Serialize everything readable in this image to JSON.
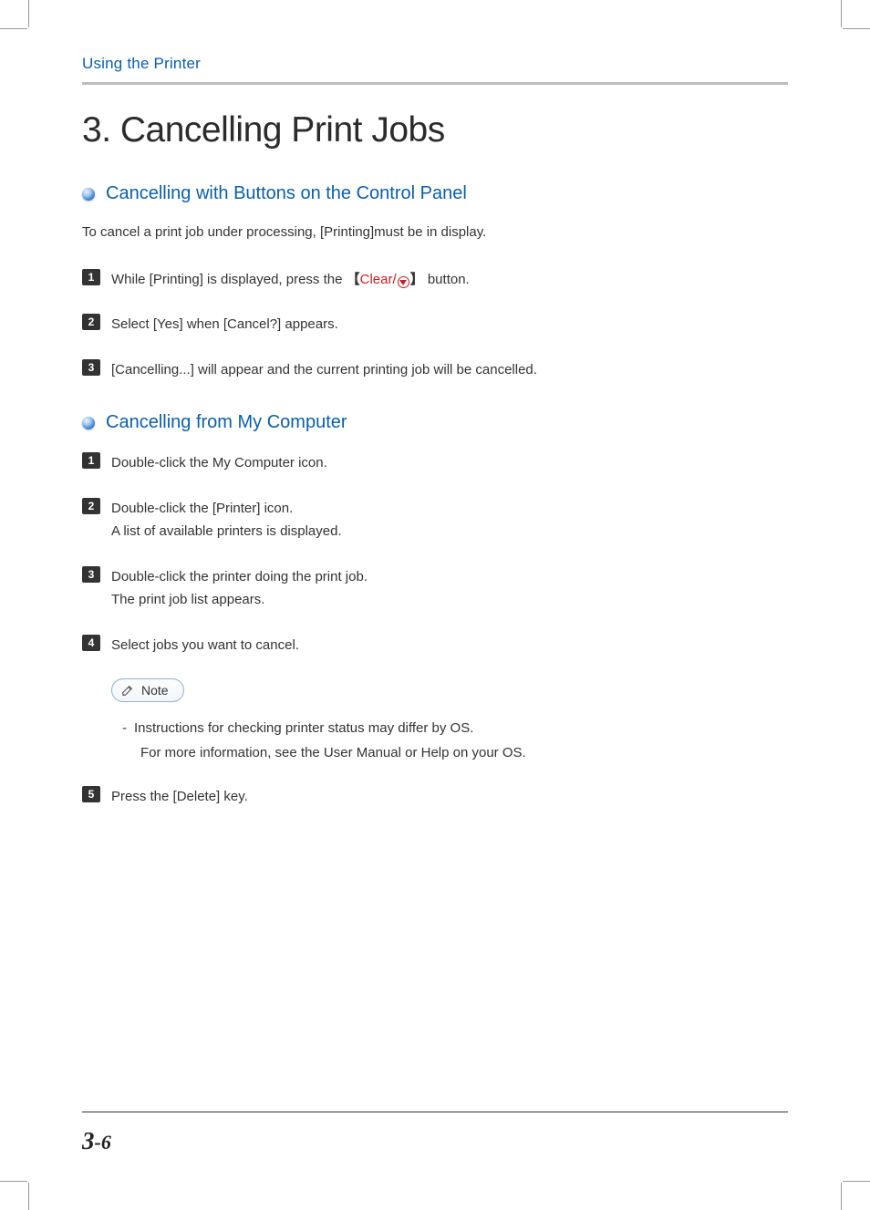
{
  "header": {
    "breadcrumb": "Using the Printer"
  },
  "chapter": {
    "title": "3. Cancelling Print Jobs"
  },
  "section1": {
    "title": "Cancelling with Buttons on the Control Panel",
    "intro": "To cancel a print job under processing, [Printing]must be in display.",
    "steps": {
      "s1_pre": "While [Printing] is displayed, press the",
      "s1_bracket_open": "【",
      "s1_clear": "Clear/",
      "s1_bracket_close": "】",
      "s1_post": "button.",
      "s2": "Select [Yes] when [Cancel?] appears.",
      "s3": "[Cancelling...] will appear and the current printing job will be cancelled."
    }
  },
  "section2": {
    "title": "Cancelling from My Computer",
    "steps": {
      "s1": "Double-click the My Computer icon.",
      "s2a": "Double-click the [Printer] icon.",
      "s2b": "A list of available printers is displayed.",
      "s3a": "Double-click the printer doing the print job.",
      "s3b": "The print job list appears.",
      "s4": "Select jobs you want to cancel.",
      "s5": "Press the [Delete] key."
    }
  },
  "note": {
    "label": "Note",
    "line1": "Instructions for checking printer status may differ by OS.",
    "line2": "For more information, see the User Manual or Help on your OS."
  },
  "footer": {
    "chapter": "3",
    "dash": "-",
    "page": "6"
  },
  "step_numbers": {
    "n1": "1",
    "n2": "2",
    "n3": "3",
    "n4": "4",
    "n5": "5"
  }
}
